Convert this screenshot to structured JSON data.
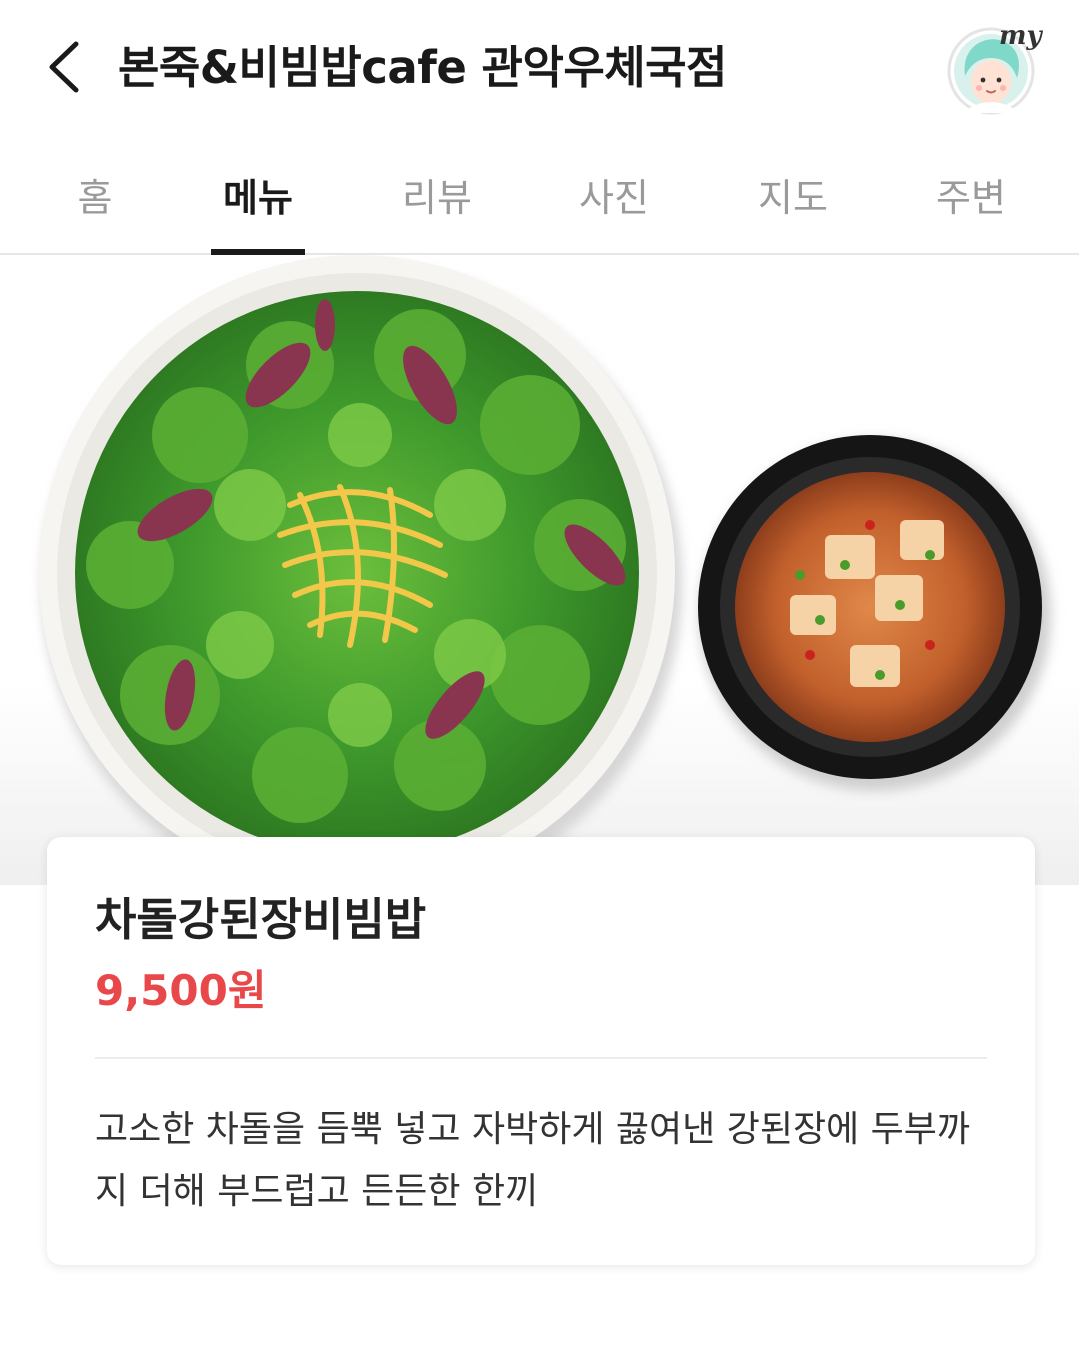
{
  "header": {
    "title": "본죽&비빔밥cafe 관악우체국점",
    "back_icon": "chevron-left-icon",
    "my_label": "my"
  },
  "tabs": [
    {
      "label": "홈",
      "active": false
    },
    {
      "label": "메뉴",
      "active": true
    },
    {
      "label": "리뷰",
      "active": false
    },
    {
      "label": "사진",
      "active": false
    },
    {
      "label": "지도",
      "active": false
    },
    {
      "label": "주변",
      "active": false
    }
  ],
  "menu": {
    "name": "차돌강된장비빔밥",
    "price": "9,500원",
    "description": "고소한 차돌을 듬뿍 넣고 자박하게 끓여낸 강된장에 두부까지 더해 부드럽고 든든한 한끼"
  },
  "colors": {
    "price": "#e8484a",
    "active_tab": "#1a1a1a",
    "inactive_tab": "#9a9a9a",
    "avatar_hair": "#7fd8c8"
  }
}
